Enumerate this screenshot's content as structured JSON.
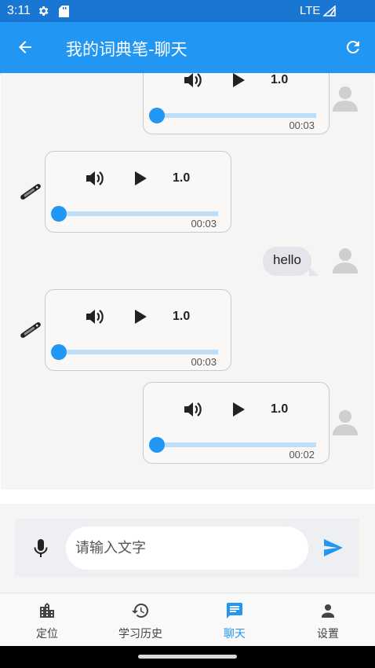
{
  "status_bar": {
    "time": "3:11",
    "network": "LTE"
  },
  "app_bar": {
    "title": "我的词典笔-聊天"
  },
  "messages": [
    {
      "type": "audio",
      "from": "user",
      "speed": "1.0",
      "duration": "00:03",
      "progress": 0,
      "partial": true
    },
    {
      "type": "audio",
      "from": "pen",
      "speed": "1.0",
      "duration": "00:03",
      "progress": 0
    },
    {
      "type": "text",
      "from": "user",
      "text": "hello"
    },
    {
      "type": "audio",
      "from": "pen",
      "speed": "1.0",
      "duration": "00:03",
      "progress": 0
    },
    {
      "type": "audio",
      "from": "user",
      "speed": "1.0",
      "duration": "00:02",
      "progress": 0
    }
  ],
  "input": {
    "placeholder": "请输入文字",
    "value": ""
  },
  "bottom_nav": {
    "items": [
      {
        "label": "定位",
        "icon": "location-city-icon",
        "active": false
      },
      {
        "label": "学习历史",
        "icon": "history-icon",
        "active": false
      },
      {
        "label": "聊天",
        "icon": "chat-icon",
        "active": true
      },
      {
        "label": "设置",
        "icon": "person-icon",
        "active": false
      }
    ]
  },
  "colors": {
    "primary": "#2196f3",
    "status_bar": "#1976d2",
    "track": "#bbdefb"
  }
}
